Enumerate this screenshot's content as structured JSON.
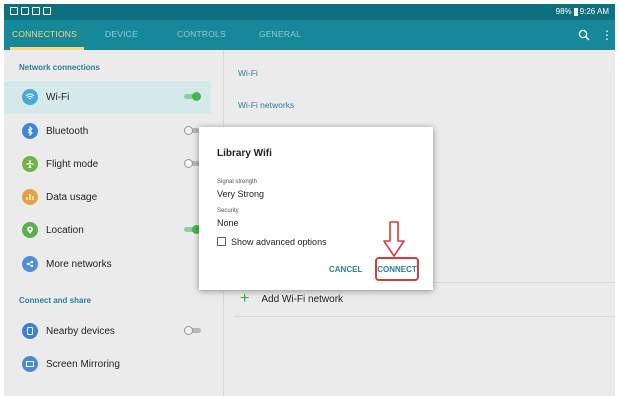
{
  "status_bar": {
    "battery": "98%",
    "time": "9:26 AM",
    "icons": [
      "notification-icon",
      "screenshot-icon",
      "signal-icon",
      "alert-icon"
    ]
  },
  "tabs": [
    {
      "label": "CONNECTIONS",
      "active": true
    },
    {
      "label": "DEVICE",
      "active": false
    },
    {
      "label": "CONTROLS",
      "active": false
    },
    {
      "label": "GENERAL",
      "active": false
    }
  ],
  "sidebar": {
    "section1_header": "Network connections",
    "items": [
      {
        "label": "Wi-Fi",
        "icon": "wifi-icon",
        "toggle": "on",
        "selected": true,
        "color": "#4aa8d8"
      },
      {
        "label": "Bluetooth",
        "icon": "bluetooth-icon",
        "toggle": "off",
        "color": "#3f86d8"
      },
      {
        "label": "Flight mode",
        "icon": "airplane-icon",
        "toggle": "off",
        "color": "#72b447"
      },
      {
        "label": "Data usage",
        "icon": "data-usage-icon",
        "toggle": null,
        "color": "#e9a13b"
      },
      {
        "label": "Location",
        "icon": "location-icon",
        "toggle": "on",
        "color": "#5cae4a"
      },
      {
        "label": "More networks",
        "icon": "more-networks-icon",
        "toggle": null,
        "color": "#4f8fd8"
      }
    ],
    "section2_header": "Connect and share",
    "items2": [
      {
        "label": "Nearby devices",
        "icon": "nearby-devices-icon",
        "toggle": "off",
        "color": "#3f7fd8"
      },
      {
        "label": "Screen Mirroring",
        "icon": "screen-mirroring-icon",
        "toggle": null,
        "color": "#4a8ad8"
      }
    ]
  },
  "main": {
    "title": "Wi-Fi",
    "subheader": "Wi-Fi networks",
    "add_network": "Add Wi-Fi network"
  },
  "dialog": {
    "title": "Library Wifi",
    "signal_label": "Signal strength",
    "signal_value": "Very Strong",
    "security_label": "Security",
    "security_value": "None",
    "checkbox_label": "Show advanced options",
    "cancel": "CANCEL",
    "connect": "CONNECT"
  },
  "colors": {
    "header": "#17889a",
    "status_bar": "#0e6f7e",
    "active_tab": "#ffd77a",
    "accent": "#2a7f96",
    "highlight_red": "#d63c3c"
  }
}
